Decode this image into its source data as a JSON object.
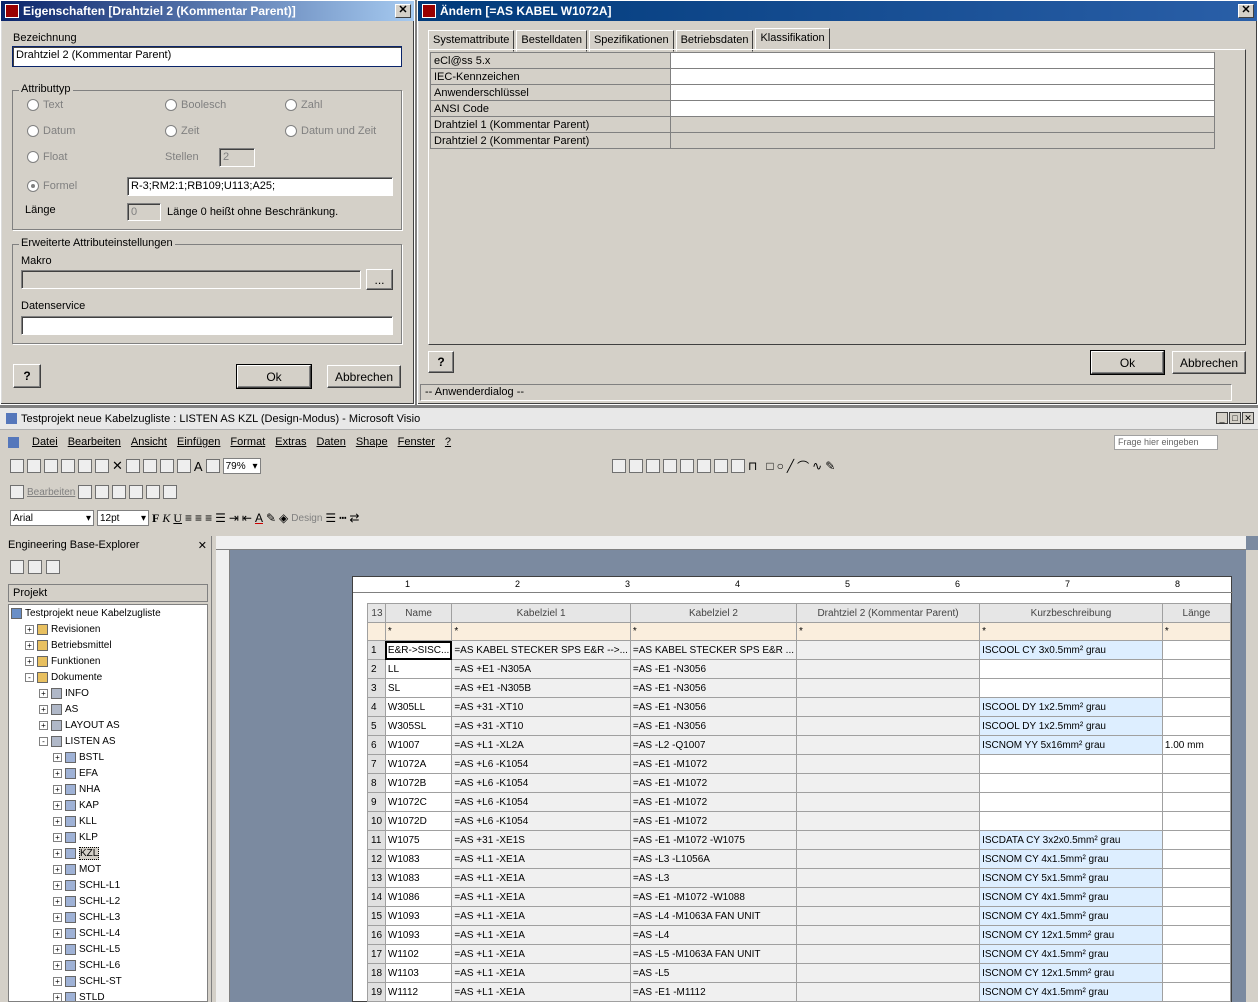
{
  "eig": {
    "title": "Eigenschaften [Drahtziel 2 (Kommentar Parent)]",
    "bezeichnung_label": "Bezeichnung",
    "bezeichnung_value": "Drahtziel 2 (Kommentar Parent)",
    "attributtyp_label": "Attributtyp",
    "types": {
      "text": "Text",
      "boolesch": "Boolesch",
      "zahl": "Zahl",
      "datum": "Datum",
      "zeit": "Zeit",
      "datumzeit": "Datum und Zeit",
      "float": "Float",
      "formel": "Formel"
    },
    "stellen_label": "Stellen",
    "stellen_value": "2",
    "formel_value": "R-3;RM2:1;RB109;U113;A25;",
    "laenge_label": "Länge",
    "laenge_value": "0",
    "laenge_hint": "Länge 0 heißt ohne Beschränkung.",
    "erweitert_label": "Erweiterte Attributeinstellungen",
    "makro_label": "Makro",
    "browse_label": "...",
    "datenservice_label": "Datenservice",
    "help_label": "?",
    "ok_label": "Ok",
    "cancel_label": "Abbrechen"
  },
  "aend": {
    "title": "Ändern [=AS KABEL W1072A]",
    "tabs": [
      "Systemattribute",
      "Bestelldaten",
      "Spezifikationen",
      "Betriebsdaten",
      "Klassifikation"
    ],
    "active_tab": "Klassifikation",
    "rows": [
      "eCl@ss 5.x",
      "IEC-Kennzeichen",
      "Anwenderschlüssel",
      "ANSI Code",
      "Drahtziel 1 (Kommentar Parent)",
      "Drahtziel 2 (Kommentar Parent)"
    ],
    "help_label": "?",
    "ok_label": "Ok",
    "cancel_label": "Abbrechen",
    "status": "-- Anwenderdialog --"
  },
  "visio": {
    "title": "Testprojekt neue Kabelzugliste : LISTEN AS KZL (Design-Modus) - Microsoft Visio",
    "menu": [
      "Datei",
      "Bearbeiten",
      "Ansicht",
      "Einfügen",
      "Format",
      "Extras",
      "Daten",
      "Shape",
      "Fenster",
      "?"
    ],
    "help_placeholder": "Frage hier eingeben",
    "zoom": "79%",
    "bearbeiten_label": "Bearbeiten",
    "design_label": "Design",
    "font": "Arial",
    "font_size": "12pt",
    "explorer_title": "Engineering Base-Explorer",
    "projekt_label": "Projekt",
    "tree": [
      {
        "label": "Testprojekt neue Kabelzugliste",
        "level": 0,
        "pm": ""
      },
      {
        "label": "Revisionen",
        "level": 1,
        "pm": "+"
      },
      {
        "label": "Betriebsmittel",
        "level": 1,
        "pm": "+"
      },
      {
        "label": "Funktionen",
        "level": 1,
        "pm": "+"
      },
      {
        "label": "Dokumente",
        "level": 1,
        "pm": "-"
      },
      {
        "label": "INFO",
        "level": 2,
        "pm": "+"
      },
      {
        "label": "AS",
        "level": 2,
        "pm": "+"
      },
      {
        "label": "LAYOUT AS",
        "level": 2,
        "pm": "+"
      },
      {
        "label": "LISTEN AS",
        "level": 2,
        "pm": "-"
      },
      {
        "label": "BSTL",
        "level": 3,
        "pm": "+"
      },
      {
        "label": "EFA",
        "level": 3,
        "pm": "+"
      },
      {
        "label": "NHA",
        "level": 3,
        "pm": "+"
      },
      {
        "label": "KAP",
        "level": 3,
        "pm": "+"
      },
      {
        "label": "KLL",
        "level": 3,
        "pm": "+"
      },
      {
        "label": "KLP",
        "level": 3,
        "pm": "+"
      },
      {
        "label": "KZL",
        "level": 3,
        "pm": "+"
      },
      {
        "label": "MOT",
        "level": 3,
        "pm": "+"
      },
      {
        "label": "SCHL-L1",
        "level": 3,
        "pm": "+"
      },
      {
        "label": "SCHL-L2",
        "level": 3,
        "pm": "+"
      },
      {
        "label": "SCHL-L3",
        "level": 3,
        "pm": "+"
      },
      {
        "label": "SCHL-L4",
        "level": 3,
        "pm": "+"
      },
      {
        "label": "SCHL-L5",
        "level": 3,
        "pm": "+"
      },
      {
        "label": "SCHL-L6",
        "level": 3,
        "pm": "+"
      },
      {
        "label": "SCHL-ST",
        "level": 3,
        "pm": "+"
      },
      {
        "label": "STLD",
        "level": 3,
        "pm": "+"
      }
    ],
    "page_col_nums": [
      "1",
      "2",
      "3",
      "4",
      "5",
      "6",
      "7",
      "8"
    ],
    "columns": [
      "Name",
      "Kabelziel 1",
      "Kabelziel 2",
      "Drahtziel 2 (Kommentar Parent)",
      "Kurzbeschreibung",
      "Länge"
    ],
    "header_num": "13",
    "filter_row": [
      "*",
      "*",
      "*",
      "*",
      "*",
      "*"
    ],
    "rows": [
      {
        "n": "1",
        "name": "E&R->SISC...",
        "z1": "=AS KABEL STECKER SPS E&R -->...",
        "z2": "=AS KABEL STECKER SPS E&R ...",
        "kurz": "ISCOOL CY 3x0.5mm² grau",
        "len": ""
      },
      {
        "n": "2",
        "name": "LL",
        "z1": "=AS +E1 -N305A",
        "z2": "=AS -E1 -N3056",
        "kurz": "",
        "len": ""
      },
      {
        "n": "3",
        "name": "SL",
        "z1": "=AS +E1 -N305B",
        "z2": "=AS -E1 -N3056",
        "kurz": "",
        "len": ""
      },
      {
        "n": "4",
        "name": "W305LL",
        "z1": "=AS +31 -XT10",
        "z2": "=AS -E1 -N3056",
        "kurz": "ISCOOL DY 1x2.5mm² grau",
        "len": ""
      },
      {
        "n": "5",
        "name": "W305SL",
        "z1": "=AS +31 -XT10",
        "z2": "=AS -E1 -N3056",
        "kurz": "ISCOOL DY 1x2.5mm² grau",
        "len": ""
      },
      {
        "n": "6",
        "name": "W1007",
        "z1": "=AS +L1 -XL2A",
        "z2": "=AS -L2 -Q1007",
        "kurz": "ISCNOM YY 5x16mm² grau",
        "len": "1.00 mm"
      },
      {
        "n": "7",
        "name": "W1072A",
        "z1": "=AS +L6 -K1054",
        "z2": "=AS -E1 -M1072",
        "kurz": "",
        "len": ""
      },
      {
        "n": "8",
        "name": "W1072B",
        "z1": "=AS +L6 -K1054",
        "z2": "=AS -E1 -M1072",
        "kurz": "",
        "len": ""
      },
      {
        "n": "9",
        "name": "W1072C",
        "z1": "=AS +L6 -K1054",
        "z2": "=AS -E1 -M1072",
        "kurz": "",
        "len": ""
      },
      {
        "n": "10",
        "name": "W1072D",
        "z1": "=AS +L6 -K1054",
        "z2": "=AS -E1 -M1072",
        "kurz": "",
        "len": ""
      },
      {
        "n": "11",
        "name": "W1075",
        "z1": "=AS +31 -XE1S",
        "z2": "=AS -E1 -M1072 -W1075",
        "kurz": "ISCDATA CY 3x2x0.5mm² grau",
        "len": ""
      },
      {
        "n": "12",
        "name": "W1083",
        "z1": "=AS +L1 -XE1A",
        "z2": "=AS -L3 -L1056A",
        "kurz": "ISCNOM CY 4x1.5mm² grau",
        "len": ""
      },
      {
        "n": "13",
        "name": "W1083",
        "z1": "=AS +L1 -XE1A",
        "z2": "=AS -L3",
        "kurz": "ISCNOM CY 5x1.5mm² grau",
        "len": ""
      },
      {
        "n": "14",
        "name": "W1086",
        "z1": "=AS +L1 -XE1A",
        "z2": "=AS -E1 -M1072 -W1088",
        "kurz": "ISCNOM CY 4x1.5mm² grau",
        "len": ""
      },
      {
        "n": "15",
        "name": "W1093",
        "z1": "=AS +L1 -XE1A",
        "z2": "=AS -L4 -M1063A FAN UNIT",
        "kurz": "ISCNOM CY 4x1.5mm² grau",
        "len": ""
      },
      {
        "n": "16",
        "name": "W1093",
        "z1": "=AS +L1 -XE1A",
        "z2": "=AS -L4",
        "kurz": "ISCNOM CY 12x1.5mm² grau",
        "len": ""
      },
      {
        "n": "17",
        "name": "W1102",
        "z1": "=AS +L1 -XE1A",
        "z2": "=AS -L5 -M1063A FAN UNIT",
        "kurz": "ISCNOM CY 4x1.5mm² grau",
        "len": ""
      },
      {
        "n": "18",
        "name": "W1103",
        "z1": "=AS +L1 -XE1A",
        "z2": "=AS -L5",
        "kurz": "ISCNOM CY 12x1.5mm² grau",
        "len": ""
      },
      {
        "n": "19",
        "name": "W1112",
        "z1": "=AS +L1 -XE1A",
        "z2": "=AS -E1 -M1112",
        "kurz": "ISCNOM CY 4x1.5mm² grau",
        "len": ""
      }
    ]
  }
}
